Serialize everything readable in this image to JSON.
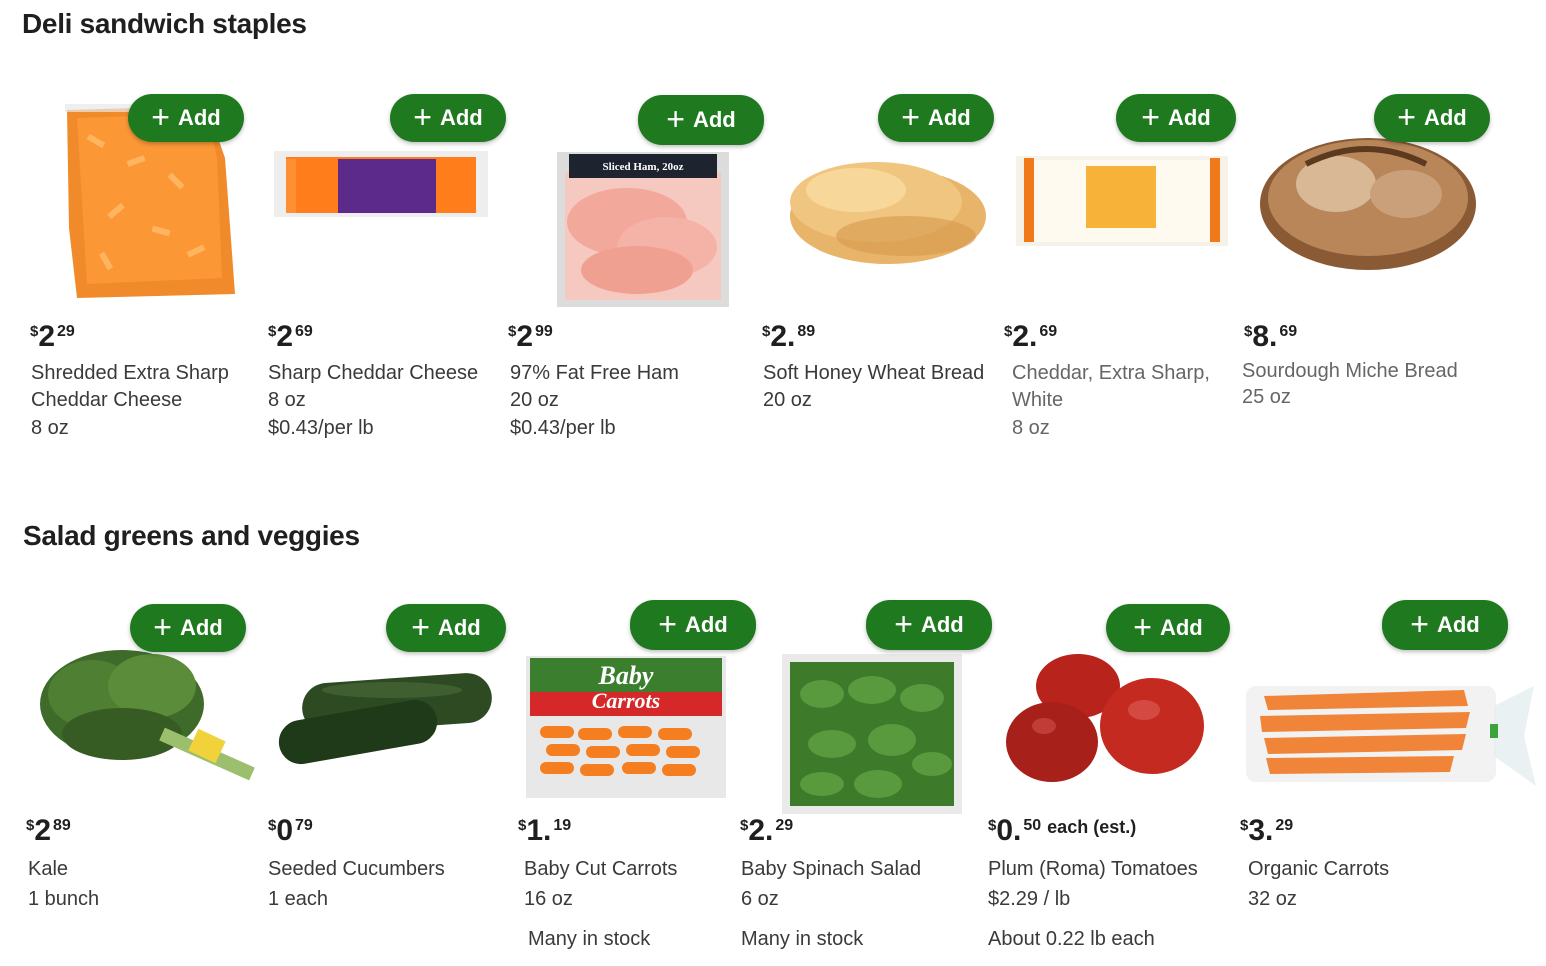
{
  "sections": [
    {
      "title": "Deli sandwich staples",
      "products": [
        {
          "price_dollars": "2",
          "price_cents": "29",
          "name_lines": [
            "Shredded Extra Sharp",
            "Cheddar Cheese"
          ],
          "size": "8 oz",
          "unit_price": "",
          "add_label": "Add"
        },
        {
          "price_dollars": "2",
          "price_cents": "69",
          "name_lines": [
            "Sharp Cheddar Cheese"
          ],
          "size": "8 oz",
          "unit_price": "$0.43/per lb",
          "add_label": "Add"
        },
        {
          "price_dollars": "2",
          "price_cents": "99",
          "name_lines": [
            "97% Fat Free Ham"
          ],
          "size": "20 oz",
          "unit_price": "$0.43/per lb",
          "add_label": "Add",
          "package_label": "Sliced Ham, 20oz"
        },
        {
          "price_dollars": "2.",
          "price_cents": "89",
          "name_lines": [
            "Soft Honey Wheat Bread"
          ],
          "size": "20 oz",
          "unit_price": "",
          "add_label": "Add"
        },
        {
          "price_dollars": "2.",
          "price_cents": "69",
          "name_lines": [
            "Cheddar, Extra Sharp,",
            "White"
          ],
          "size": "8 oz",
          "unit_price": "",
          "add_label": "Add"
        },
        {
          "price_dollars": "8.",
          "price_cents": "69",
          "name_lines": [
            "Sourdough Miche Bread"
          ],
          "size": "25 oz",
          "unit_price": "",
          "add_label": "Add"
        }
      ]
    },
    {
      "title": "Salad greens and veggies",
      "products": [
        {
          "price_dollars": "2",
          "price_cents": "89",
          "price_suffix": "",
          "name": "Kale",
          "size": "1 bunch",
          "extra": "",
          "add_label": "Add"
        },
        {
          "price_dollars": "0",
          "price_cents": "79",
          "price_suffix": "",
          "name": "Seeded Cucumbers",
          "size": "1 each",
          "extra": "",
          "add_label": "Add"
        },
        {
          "price_dollars": "1.",
          "price_cents": "19",
          "price_suffix": "",
          "name": "Baby Cut Carrots",
          "size": "16 oz",
          "extra": "Many in stock",
          "add_label": "Add",
          "package_label_1": "Baby",
          "package_label_2": "Carrots"
        },
        {
          "price_dollars": "2.",
          "price_cents": "29",
          "price_suffix": "",
          "name": "Baby Spinach Salad",
          "size": "6 oz",
          "extra": "Many in stock",
          "add_label": "Add"
        },
        {
          "price_dollars": "0.",
          "price_cents": "50",
          "price_suffix": "each (est.)",
          "name": "Plum (Roma) Tomatoes",
          "size": "$2.29 / lb",
          "extra": "About 0.22 lb each",
          "add_label": "Add"
        },
        {
          "price_dollars": "3.",
          "price_cents": "29",
          "price_suffix": "",
          "name": "Organic Carrots",
          "size": "32 oz",
          "extra": "",
          "add_label": "Add"
        }
      ]
    }
  ],
  "currency_symbol": "$",
  "colors": {
    "add_button": "#1f7a1f",
    "text": "#343538"
  }
}
